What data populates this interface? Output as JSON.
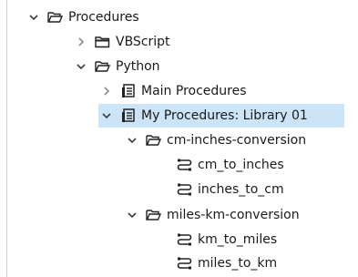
{
  "tree": {
    "procedures": {
      "label": "Procedures",
      "expanded": true,
      "icon": "open-folder-icon"
    },
    "vbscript": {
      "label": "VBScript",
      "expanded": false,
      "icon": "folder-icon"
    },
    "python": {
      "label": "Python",
      "expanded": true,
      "icon": "open-folder-icon"
    },
    "main_procedures": {
      "label": "Main Procedures",
      "expanded": false,
      "icon": "library-icon"
    },
    "my_procedures": {
      "label": "My Procedures: Library 01",
      "expanded": true,
      "selected": true,
      "icon": "library-icon"
    },
    "cm_inches": {
      "label": "cm-inches-conversion",
      "expanded": true,
      "icon": "open-folder-icon"
    },
    "cm_to_inches": {
      "label": "cm_to_inches",
      "icon": "procedure-icon"
    },
    "inches_to_cm": {
      "label": "inches_to_cm",
      "icon": "procedure-icon"
    },
    "miles_km": {
      "label": "miles-km-conversion",
      "expanded": true,
      "icon": "open-folder-icon"
    },
    "km_to_miles": {
      "label": "km_to_miles",
      "icon": "procedure-icon"
    },
    "miles_to_km": {
      "label": "miles_to_km",
      "icon": "procedure-icon"
    }
  },
  "colors": {
    "selection": "#cce4f7",
    "chevron": "#3c3c3c",
    "icon": "#222222"
  }
}
